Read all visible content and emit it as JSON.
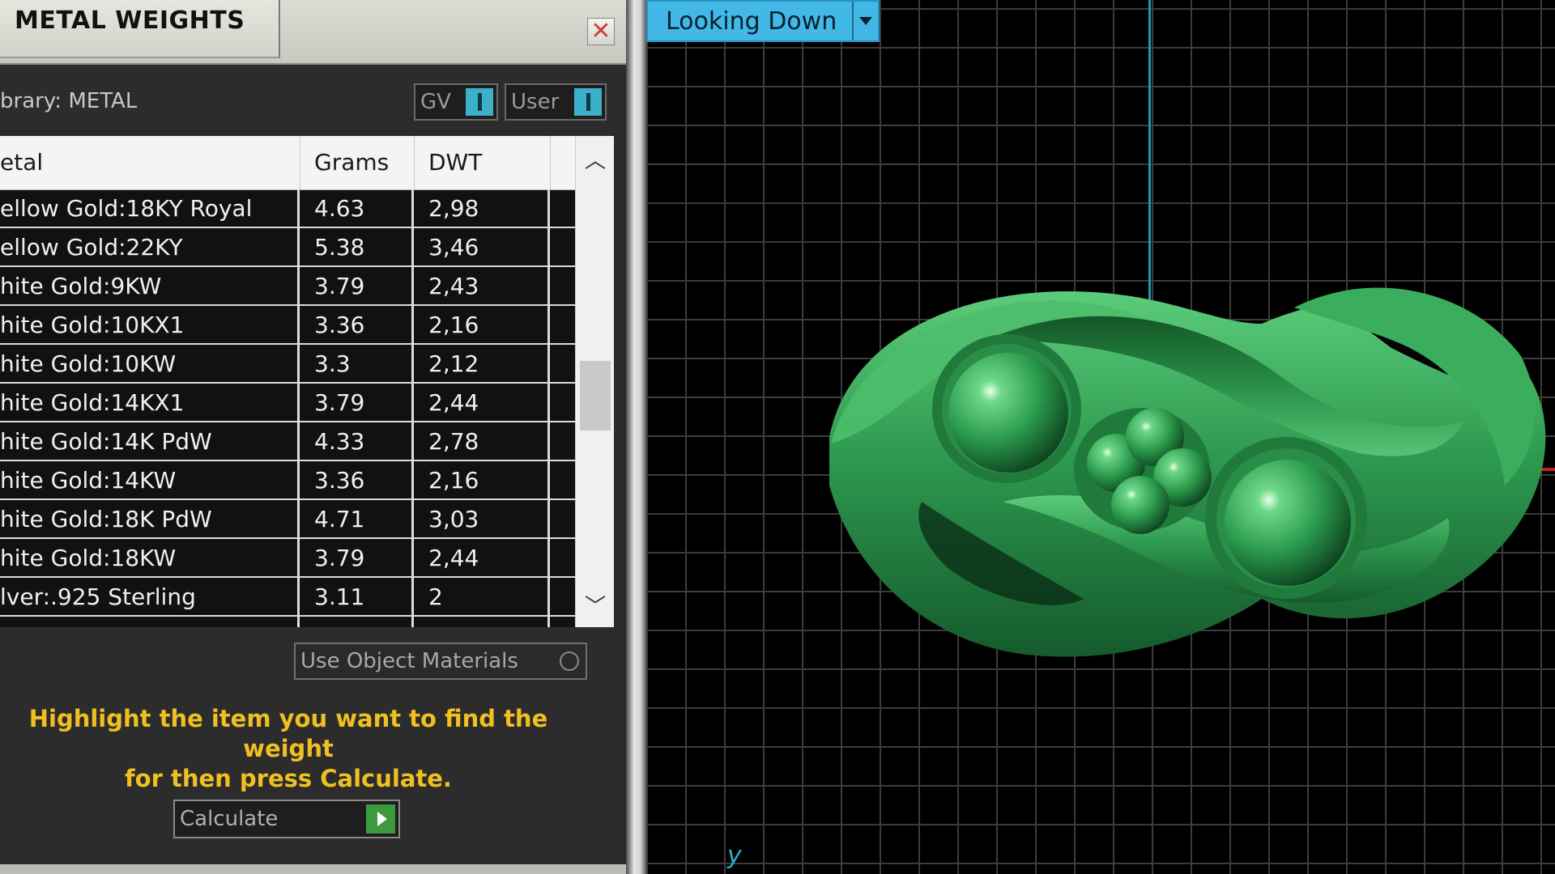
{
  "panel": {
    "title": "METAL WEIGHTS",
    "close_icon": "close-icon",
    "library_label": "brary: METAL",
    "toggles": [
      {
        "label": "GV"
      },
      {
        "label": "User"
      }
    ]
  },
  "table": {
    "columns": [
      "etal",
      "Grams",
      "DWT"
    ],
    "rows": [
      {
        "metal": "ellow Gold:18KY Royal",
        "grams": "4.63",
        "dwt": "2,98"
      },
      {
        "metal": "ellow Gold:22KY",
        "grams": "5.38",
        "dwt": "3,46"
      },
      {
        "metal": "hite Gold:9KW",
        "grams": "3.79",
        "dwt": "2,43"
      },
      {
        "metal": "hite Gold:10KX1",
        "grams": "3.36",
        "dwt": "2,16"
      },
      {
        "metal": "hite Gold:10KW",
        "grams": "3.3",
        "dwt": "2,12"
      },
      {
        "metal": "hite Gold:14KX1",
        "grams": "3.79",
        "dwt": "2,44"
      },
      {
        "metal": "hite Gold:14K PdW",
        "grams": "4.33",
        "dwt": "2,78"
      },
      {
        "metal": "hite Gold:14KW",
        "grams": "3.36",
        "dwt": "2,16"
      },
      {
        "metal": "hite Gold:18K PdW",
        "grams": "4.71",
        "dwt": "3,03"
      },
      {
        "metal": "hite Gold:18KW",
        "grams": "3.79",
        "dwt": "2,44"
      },
      {
        "metal": "lver:.925 Sterling",
        "grams": "3.11",
        "dwt": "2"
      }
    ]
  },
  "use_object_materials": "Use Object Materials",
  "hint": {
    "line1": "Highlight the item you want to find the weight",
    "line2": "for then press Calculate."
  },
  "calculate_label": "Calculate",
  "viewport": {
    "view_label": "Looking Down",
    "axis_label": "y"
  },
  "colors": {
    "view_accent": "#41b8e6",
    "hint_text": "#f0c020",
    "model_green": "#2e9a50",
    "axis_x": "#c82020",
    "axis_y": "#1e9ab0"
  }
}
